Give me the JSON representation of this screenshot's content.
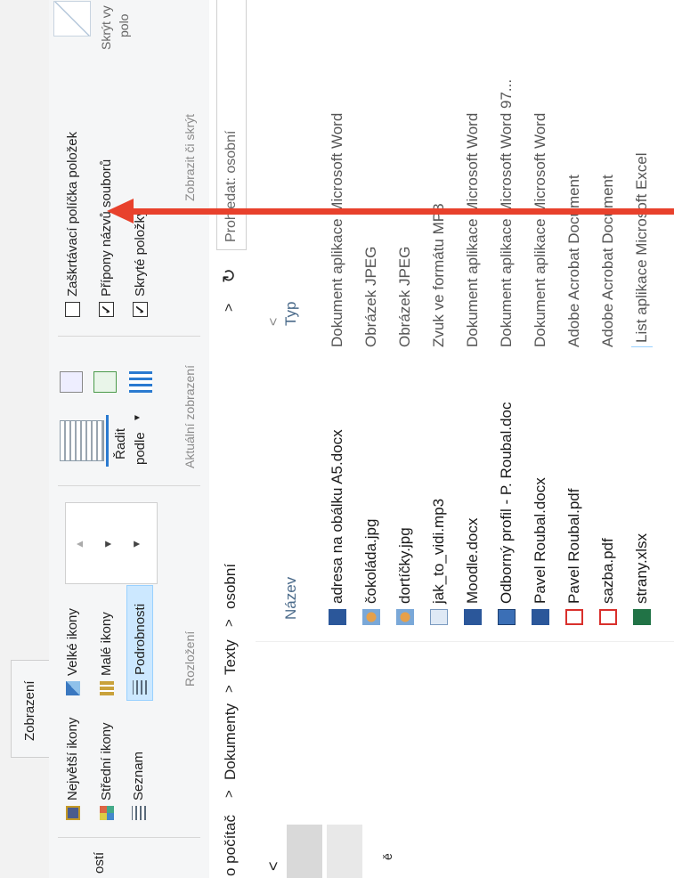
{
  "ribbon": {
    "tab_label": "Zobrazení",
    "left_fragment": "ostí",
    "layout": {
      "items": [
        {
          "label": "Největší ikony",
          "icon": "extra-large-icons-icon"
        },
        {
          "label": "Velké ikony",
          "icon": "large-icons-icon"
        },
        {
          "label": "Střední ikony",
          "icon": "medium-icons-icon"
        },
        {
          "label": "Malé ikony",
          "icon": "small-icons-icon"
        },
        {
          "label": "Seznam",
          "icon": "list-icon"
        },
        {
          "label": "Podrobnosti",
          "icon": "details-icon",
          "selected": true
        }
      ],
      "group_label": "Rozložení"
    },
    "current_view": {
      "sort_label_line1": "Řadit",
      "sort_label_line2": "podle",
      "group_label": "Aktuální zobrazení"
    },
    "show_hide": {
      "checkboxes": [
        {
          "label": "Zaškrtávací políčka položek",
          "checked": false
        },
        {
          "label": "Přípony názvů souborů",
          "checked": true
        },
        {
          "label": "Skryté položky",
          "checked": true
        }
      ],
      "group_label": "Zobrazit či skrýt",
      "hide_selected_line1": "Skrýt vy",
      "hide_selected_line2": "polo"
    }
  },
  "address_bar": {
    "breadcrumbs": [
      "o počítač",
      "Dokumenty",
      "Texty",
      "osobní"
    ],
    "separator": ">",
    "search_placeholder": "Prohledat: osobní",
    "refresh_symbol": "↻",
    "dropdown_symbol": ">"
  },
  "file_list": {
    "columns": {
      "name": "Název",
      "type": "Typ"
    },
    "collapse_symbol": "<",
    "files": [
      {
        "name": "adresa na obálku A5.docx",
        "type": "Dokument aplikace Microsoft Word",
        "icon": "word-icon"
      },
      {
        "name": "čokoláda.jpg",
        "type": "Obrázek JPEG",
        "icon": "jpeg-icon"
      },
      {
        "name": "dortíčky.jpg",
        "type": "Obrázek JPEG",
        "icon": "jpeg-icon"
      },
      {
        "name": "jak_to_vidi.mp3",
        "type": "Zvuk ve formátu MP3",
        "icon": "mp3-icon"
      },
      {
        "name": "Moodle.docx",
        "type": "Dokument aplikace Microsoft Word",
        "icon": "word-icon"
      },
      {
        "name": "Odborný profil - P. Roubal.doc",
        "type": "Dokument aplikace Microsoft Word 97...",
        "icon": "word-doc-icon"
      },
      {
        "name": "Pavel Roubal.docx",
        "type": "Dokument aplikace Microsoft Word",
        "icon": "word-icon"
      },
      {
        "name": "Pavel Roubal.pdf",
        "type": "Adobe Acrobat Document",
        "icon": "pdf-icon"
      },
      {
        "name": "sazba.pdf",
        "type": "Adobe Acrobat Document",
        "icon": "pdf-icon"
      },
      {
        "name": "strany.xlsx",
        "type": "List aplikace Microsoft Excel",
        "icon": "excel-icon"
      }
    ]
  },
  "nav_pane": {
    "scroll_left_symbol": "<",
    "fragment": "ě"
  },
  "annotation": {
    "color": "#e8412c",
    "points_to": "Přípony názvů souborů"
  },
  "colors": {
    "frame": "#1f3a5a",
    "selected": "#cce8ff",
    "selected_border": "#99d1ff",
    "word": "#2b579a",
    "excel": "#217346",
    "pdf": "#d9302c",
    "arrow": "#e8412c"
  }
}
